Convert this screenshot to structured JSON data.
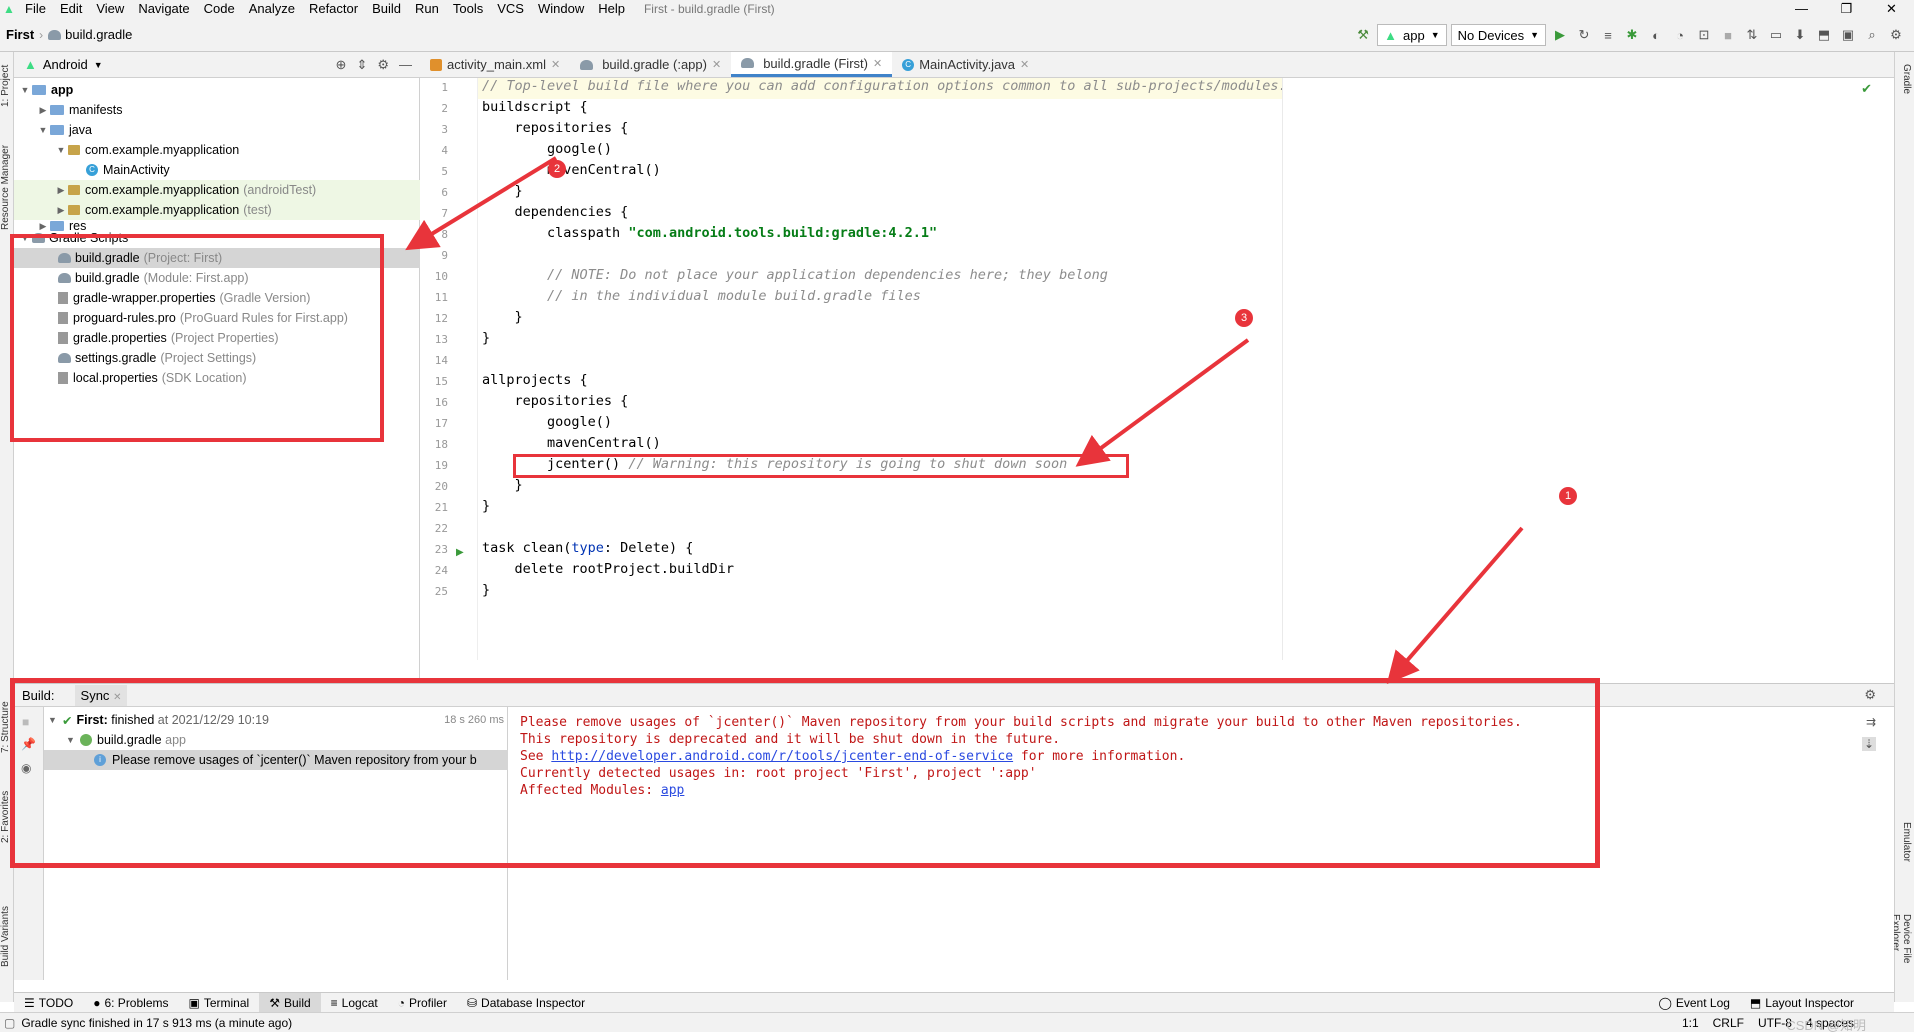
{
  "menubar": {
    "items": [
      "File",
      "Edit",
      "View",
      "Navigate",
      "Code",
      "Analyze",
      "Refactor",
      "Build",
      "Run",
      "Tools",
      "VCS",
      "Window",
      "Help"
    ],
    "title": "First - build.gradle (First)"
  },
  "navbar": {
    "project": "First",
    "file": "build.gradle"
  },
  "toolbar": {
    "config": "app",
    "device": "No Devices"
  },
  "project_panel": {
    "view": "Android",
    "tree": [
      {
        "label": "app",
        "muted": ""
      },
      {
        "label": "manifests",
        "muted": ""
      },
      {
        "label": "java",
        "muted": ""
      },
      {
        "label": "com.example.myapplication",
        "muted": ""
      },
      {
        "label": "MainActivity",
        "muted": ""
      },
      {
        "label": "com.example.myapplication",
        "muted": "(androidTest)"
      },
      {
        "label": "com.example.myapplication",
        "muted": "(test)"
      },
      {
        "label": "res",
        "muted": ""
      },
      {
        "label": "Gradle Scripts",
        "muted": ""
      },
      {
        "label": "build.gradle",
        "muted": "(Project: First)"
      },
      {
        "label": "build.gradle",
        "muted": "(Module: First.app)"
      },
      {
        "label": "gradle-wrapper.properties",
        "muted": "(Gradle Version)"
      },
      {
        "label": "proguard-rules.pro",
        "muted": "(ProGuard Rules for First.app)"
      },
      {
        "label": "gradle.properties",
        "muted": "(Project Properties)"
      },
      {
        "label": "settings.gradle",
        "muted": "(Project Settings)"
      },
      {
        "label": "local.properties",
        "muted": "(SDK Location)"
      }
    ]
  },
  "editor": {
    "tabs": [
      "activity_main.xml",
      "build.gradle (:app)",
      "build.gradle (First)",
      "MainActivity.java"
    ],
    "line_numbers": [
      "1",
      "2",
      "3",
      "4",
      "5",
      "6",
      "7",
      "8",
      "9",
      "10",
      "11",
      "12",
      "13",
      "14",
      "15",
      "16",
      "17",
      "18",
      "19",
      "20",
      "21",
      "22",
      "23",
      "24",
      "25"
    ],
    "code": {
      "l1": "// Top-level build file where you can add configuration options common to all sub-projects/modules.",
      "l2": "buildscript {",
      "l3": "    repositories {",
      "l4": "        google()",
      "l5": "        mavenCentral()",
      "l6": "    }",
      "l7": "    dependencies {",
      "l8a": "        classpath ",
      "l8b": "\"com.android.tools.build:gradle:4.2.1\"",
      "l9": "",
      "l10": "        // NOTE: Do not place your application dependencies here; they belong",
      "l11": "        // in the individual module build.gradle files",
      "l12": "    }",
      "l13": "}",
      "l14": "",
      "l15": "allprojects {",
      "l16": "    repositories {",
      "l17": "        google()",
      "l18": "        mavenCentral()",
      "l19a": "        jcenter() ",
      "l19b": "// Warning: this repository is going to shut down soon",
      "l20": "    }",
      "l21": "}",
      "l22": "",
      "l23a": "task clean(",
      "l23b": "type",
      "l23c": ": Delete) {",
      "l24": "    delete rootProject.buildDir",
      "l25": "}"
    }
  },
  "build_panel": {
    "label": "Build:",
    "tab": "Sync",
    "tree": {
      "root_name": "First:",
      "root_status": "finished",
      "root_time": "at 2021/12/29 10:19",
      "duration": "18 s 260 ms",
      "child": "build.gradle",
      "child_module": "app",
      "message": "Please remove usages of `jcenter()` Maven repository from your b"
    },
    "output": {
      "line1": "Please remove usages of `jcenter()` Maven repository from your build scripts and migrate your build to other Maven repositories.",
      "line2": "This repository is deprecated and it will be shut down in the future.",
      "line3_pre": "See ",
      "line3_link": "http://developer.android.com/r/tools/jcenter-end-of-service",
      "line3_post": " for more information.",
      "line4": "Currently detected usages in: root project 'First', project ':app'",
      "line5_pre": "Affected Modules: ",
      "line5_link": "app"
    }
  },
  "bottom_tabs": [
    "TODO",
    "6: Problems",
    "Terminal",
    "Build",
    "Logcat",
    "Profiler",
    "Database Inspector"
  ],
  "bottom_right": [
    "Event Log",
    "Layout Inspector"
  ],
  "side_labels": {
    "left": [
      "1: Project",
      "Resource Manager",
      "7: Structure",
      "2: Favorites",
      "Build Variants"
    ],
    "right": [
      "Gradle",
      "Emulator",
      "Device File Explorer"
    ]
  },
  "status": {
    "message": "Gradle sync finished in 17 s 913 ms (a minute ago)",
    "position": "1:1",
    "line_sep": "CRLF",
    "encoding": "UTF-8",
    "indent": "4 spaces",
    "watermark": "CSDN @知明"
  },
  "annotations": {
    "badges": [
      "1",
      "2",
      "3"
    ],
    "color": "#e8343b"
  }
}
